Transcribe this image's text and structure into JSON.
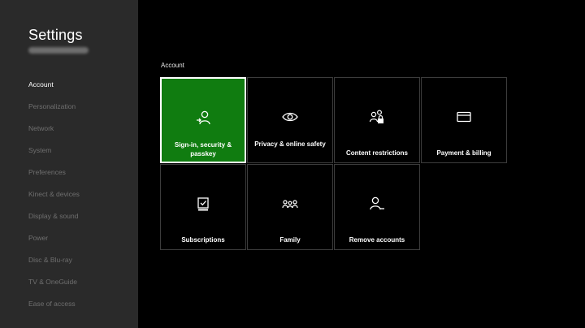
{
  "sidebar": {
    "title": "Settings",
    "items": [
      {
        "label": "Account",
        "active": true
      },
      {
        "label": "Personalization"
      },
      {
        "label": "Network"
      },
      {
        "label": "System"
      },
      {
        "label": "Preferences"
      },
      {
        "label": "Kinect & devices"
      },
      {
        "label": "Display & sound"
      },
      {
        "label": "Power"
      },
      {
        "label": "Disc & Blu-ray"
      },
      {
        "label": "TV & OneGuide"
      },
      {
        "label": "Ease of access"
      }
    ]
  },
  "main": {
    "section_label": "Account",
    "tiles": [
      {
        "label": "Sign-in, security & passkey",
        "icon": "sign-in-person-icon",
        "selected": true
      },
      {
        "label": "Privacy & online safety",
        "icon": "eye-icon"
      },
      {
        "label": "Content restrictions",
        "icon": "people-lock-icon"
      },
      {
        "label": "Payment & billing",
        "icon": "credit-card-icon"
      },
      {
        "label": "Subscriptions",
        "icon": "subscription-check-icon"
      },
      {
        "label": "Family",
        "icon": "family-icon"
      },
      {
        "label": "Remove accounts",
        "icon": "remove-person-icon"
      }
    ]
  },
  "colors": {
    "accent": "#107c10",
    "sidebar_bg": "#2a2a2a",
    "background": "#000000",
    "inactive_text": "#6f6f6f"
  }
}
